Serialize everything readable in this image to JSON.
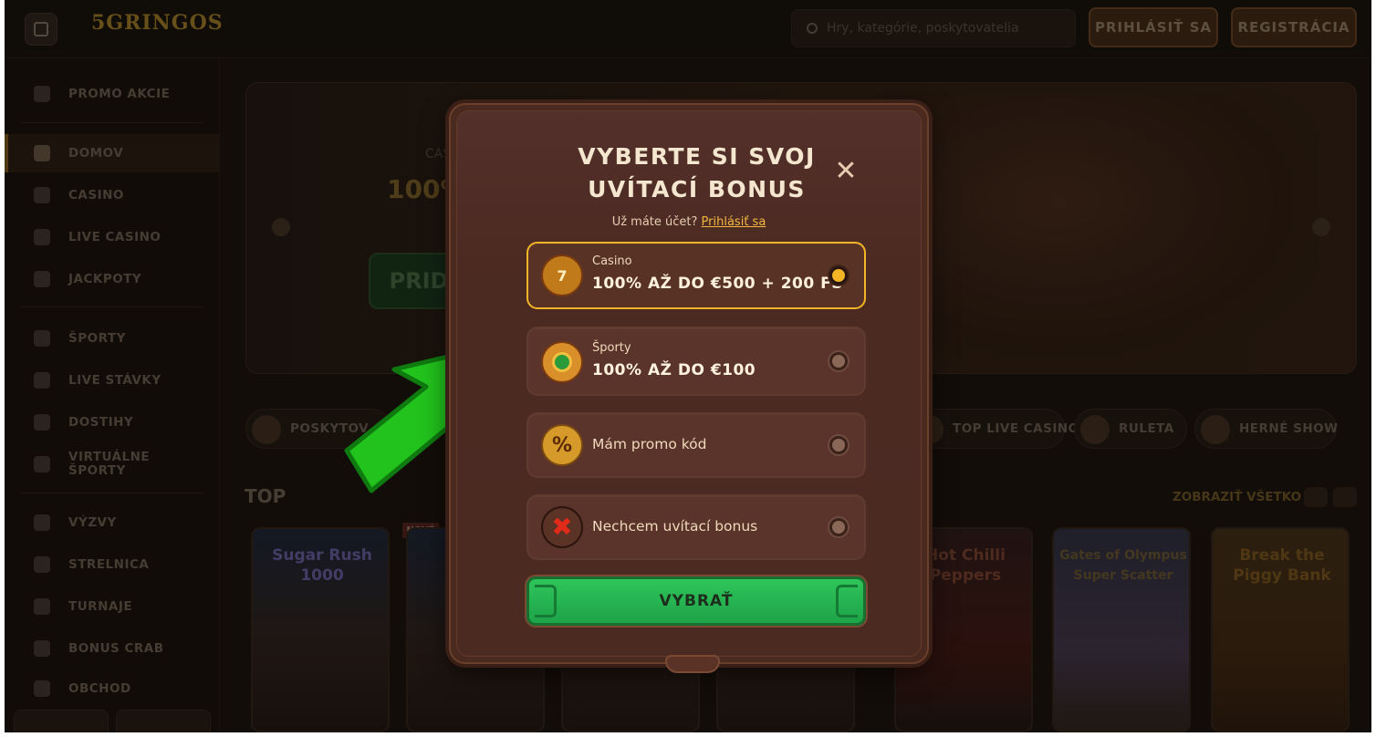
{
  "header": {
    "logo_text": "5GRINGOS",
    "search_placeholder": "Hry, kategórie, poskytovatelia",
    "login_label": "PRIHLÁSIŤ SA",
    "register_label": "REGISTRÁCIA"
  },
  "sidebar": {
    "items": [
      {
        "label": "PROMO AKCIE"
      },
      {
        "label": "DOMOV"
      },
      {
        "label": "CASINO"
      },
      {
        "label": "LIVE CASINO"
      },
      {
        "label": "JACKPOTY"
      },
      {
        "label": "ŠPORTY"
      },
      {
        "label": "LIVE STÁVKY"
      },
      {
        "label": "DOSTIHY"
      },
      {
        "label": "VIRTUÁLNE ŠPORTY"
      },
      {
        "label": "VÝZVY"
      },
      {
        "label": "STRELNICA"
      },
      {
        "label": "TURNAJE"
      },
      {
        "label": "BONUS CRAB"
      },
      {
        "label": "OBCHOD"
      }
    ]
  },
  "banner": {
    "label": "CAS",
    "headline": "100%",
    "button": "PRID"
  },
  "categories": [
    {
      "label": "POSKYTOV"
    },
    {
      "label": "TOP LIVE CASINO"
    },
    {
      "label": "RULETA"
    },
    {
      "label": "HERNÉ SHOW"
    }
  ],
  "top_section": {
    "title": "TOP",
    "view_all": "ZOBRAZIŤ VŠETKO",
    "new_badge": "NOVÉ",
    "games": [
      {
        "name": "Sugar Rush 1000"
      },
      {
        "name": "E"
      },
      {
        "name": ""
      },
      {
        "name": ""
      },
      {
        "name": "Hot Chilli Peppers"
      },
      {
        "name": "Gates of Olympus Super Scatter"
      },
      {
        "name": "Break the Piggy Bank"
      }
    ]
  },
  "modal": {
    "title_line1": "VYBERTE SI SVOJ",
    "title_line2": "UVÍTACÍ BONUS",
    "have_account": "Už máte účet?",
    "login_link": "Prihlásiť sa",
    "options": [
      {
        "small": "Casino",
        "big": "100% AŽ DO €500 + 200 FS",
        "selected": true,
        "icon": "slot-reel-icon"
      },
      {
        "small": "Športy",
        "big": "100% AŽ DO €100",
        "selected": false,
        "icon": "soccer-ball-icon"
      },
      {
        "text": "Mám promo kód",
        "selected": false,
        "icon": "percent-icon"
      },
      {
        "text": "Nechcem uvítací bonus",
        "selected": false,
        "icon": "red-x-icon"
      }
    ],
    "submit_label": "VYBRAŤ"
  },
  "colors": {
    "accent_gold": "#f2b525",
    "modal_bg": "#4a2a21",
    "submit_green": "#2fc55a",
    "arrow_green": "#22c31c"
  }
}
